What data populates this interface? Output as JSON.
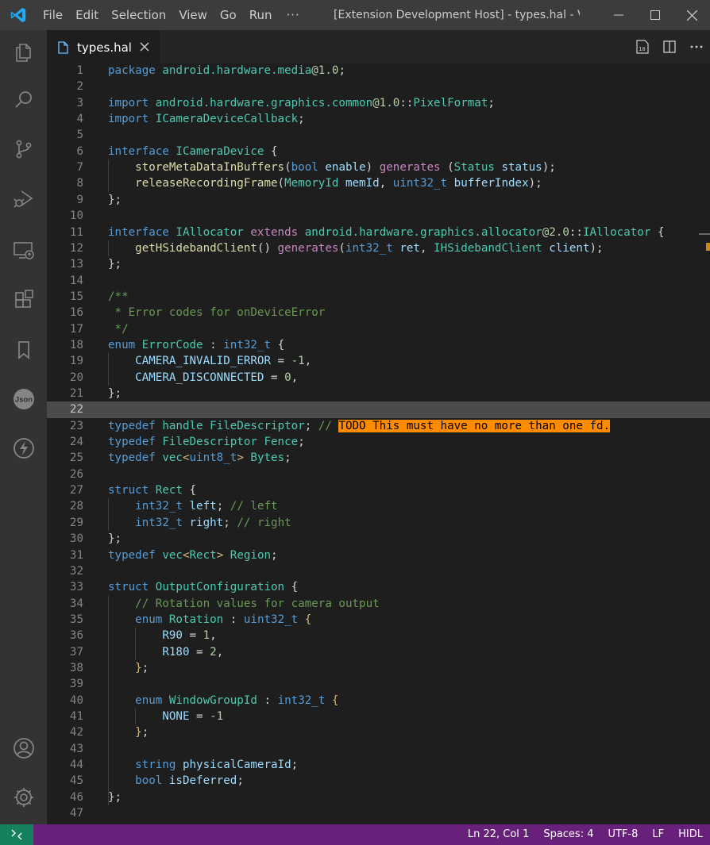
{
  "titlebar": {
    "menus": [
      "File",
      "Edit",
      "Selection",
      "View",
      "Go",
      "Run"
    ],
    "more": "···",
    "title": "[Extension Development Host] - types.hal - Vis..."
  },
  "activitybar": {
    "items": [
      "explorer-icon",
      "search-icon",
      "source-control-icon",
      "run-debug-icon",
      "remote-explorer-icon",
      "extensions-icon",
      "bookmarks-icon",
      "json-icon",
      "lightning-icon"
    ],
    "bottom": [
      "account-icon",
      "settings-gear-icon"
    ]
  },
  "tab": {
    "label": "types.hal"
  },
  "editor": {
    "current_line": 22,
    "line_numbers": [
      "1",
      "2",
      "3",
      "4",
      "5",
      "6",
      "7",
      "8",
      "9",
      "10",
      "11",
      "12",
      "13",
      "14",
      "15",
      "16",
      "17",
      "18",
      "19",
      "20",
      "21",
      "22",
      "23",
      "24",
      "25",
      "26",
      "27",
      "28",
      "29",
      "30",
      "31",
      "32",
      "33",
      "34",
      "35",
      "36",
      "37",
      "38",
      "39",
      "40",
      "41",
      "42",
      "43",
      "44",
      "45",
      "46",
      "47"
    ],
    "lines": [
      [
        [
          "kw",
          "package "
        ],
        [
          "ty",
          "android.hardware.media"
        ],
        [
          "nm",
          "@1.0"
        ],
        [
          "pl",
          ";"
        ]
      ],
      [],
      [
        [
          "kw",
          "import "
        ],
        [
          "ty",
          "android.hardware.graphics.common"
        ],
        [
          "nm",
          "@1.0"
        ],
        [
          "pl",
          "::"
        ],
        [
          "ty",
          "PixelFormat"
        ],
        [
          "pl",
          ";"
        ]
      ],
      [
        [
          "kw",
          "import "
        ],
        [
          "ty",
          "ICameraDeviceCallback"
        ],
        [
          "pl",
          ";"
        ]
      ],
      [],
      [
        [
          "kw",
          "interface "
        ],
        [
          "ty",
          "ICameraDevice "
        ],
        [
          "pl",
          "{"
        ]
      ],
      [
        [
          "pl",
          "    "
        ],
        [
          "fn",
          "storeMetaDataInBuffers"
        ],
        [
          "pl",
          "("
        ],
        [
          "kw",
          "bool "
        ],
        [
          "id",
          "enable"
        ],
        [
          "pl",
          ") "
        ],
        [
          "ky",
          "generates "
        ],
        [
          "pl",
          "("
        ],
        [
          "ty",
          "Status "
        ],
        [
          "id",
          "status"
        ],
        [
          "pl",
          ");"
        ]
      ],
      [
        [
          "pl",
          "    "
        ],
        [
          "fn",
          "releaseRecordingFrame"
        ],
        [
          "pl",
          "("
        ],
        [
          "ty",
          "MemoryId "
        ],
        [
          "id",
          "memId"
        ],
        [
          "pl",
          ", "
        ],
        [
          "kw",
          "uint32_t "
        ],
        [
          "id",
          "bufferIndex"
        ],
        [
          "pl",
          ");"
        ]
      ],
      [
        [
          "pl",
          "};"
        ]
      ],
      [],
      [
        [
          "kw",
          "interface "
        ],
        [
          "ty",
          "IAllocator "
        ],
        [
          "ky",
          "extends "
        ],
        [
          "ty",
          "android.hardware.graphics.allocator"
        ],
        [
          "nm",
          "@2.0"
        ],
        [
          "pl",
          "::"
        ],
        [
          "ty",
          "IAllocator "
        ],
        [
          "pl",
          "{"
        ]
      ],
      [
        [
          "pl",
          "    "
        ],
        [
          "fn",
          "getHSidebandClient"
        ],
        [
          "pl",
          "() "
        ],
        [
          "ky",
          "generates"
        ],
        [
          "pl",
          "("
        ],
        [
          "kw",
          "int32_t "
        ],
        [
          "id",
          "ret"
        ],
        [
          "pl",
          ", "
        ],
        [
          "ty",
          "IHSidebandClient "
        ],
        [
          "id",
          "client"
        ],
        [
          "pl",
          ");"
        ]
      ],
      [
        [
          "pl",
          "};"
        ]
      ],
      [],
      [
        [
          "cm",
          "/**"
        ]
      ],
      [
        [
          "cm",
          " * Error codes for onDeviceError"
        ]
      ],
      [
        [
          "cm",
          " */"
        ]
      ],
      [
        [
          "kw",
          "enum "
        ],
        [
          "ty",
          "ErrorCode "
        ],
        [
          "pl",
          ": "
        ],
        [
          "kw",
          "int32_t "
        ],
        [
          "pl",
          "{"
        ]
      ],
      [
        [
          "pl",
          "    "
        ],
        [
          "id",
          "CAMERA_INVALID_ERROR"
        ],
        [
          "pl",
          " = "
        ],
        [
          "nm",
          "-1"
        ],
        [
          "pl",
          ","
        ]
      ],
      [
        [
          "pl",
          "    "
        ],
        [
          "id",
          "CAMERA_DISCONNECTED"
        ],
        [
          "pl",
          " = "
        ],
        [
          "nm",
          "0"
        ],
        [
          "pl",
          ","
        ]
      ],
      [
        [
          "pl",
          "};"
        ]
      ],
      [],
      [
        [
          "kw",
          "typedef "
        ],
        [
          "ty",
          "handle FileDescriptor"
        ],
        [
          "pl",
          "; "
        ],
        [
          "cm",
          "// "
        ],
        [
          "hl",
          "TODO This must have no more than one fd."
        ]
      ],
      [
        [
          "kw",
          "typedef "
        ],
        [
          "ty",
          "FileDescriptor Fence"
        ],
        [
          "pl",
          ";"
        ]
      ],
      [
        [
          "kw",
          "typedef "
        ],
        [
          "ty",
          "vec"
        ],
        [
          "br",
          "<"
        ],
        [
          "kw",
          "uint8_t"
        ],
        [
          "br",
          "> "
        ],
        [
          "ty",
          "Bytes"
        ],
        [
          "pl",
          ";"
        ]
      ],
      [],
      [
        [
          "kw",
          "struct "
        ],
        [
          "ty",
          "Rect "
        ],
        [
          "pl",
          "{"
        ]
      ],
      [
        [
          "pl",
          "    "
        ],
        [
          "kw",
          "int32_t "
        ],
        [
          "id",
          "left"
        ],
        [
          "pl",
          "; "
        ],
        [
          "cm",
          "// left"
        ]
      ],
      [
        [
          "pl",
          "    "
        ],
        [
          "kw",
          "int32_t "
        ],
        [
          "id",
          "right"
        ],
        [
          "pl",
          "; "
        ],
        [
          "cm",
          "// right"
        ]
      ],
      [
        [
          "pl",
          "};"
        ]
      ],
      [
        [
          "kw",
          "typedef "
        ],
        [
          "ty",
          "vec"
        ],
        [
          "br",
          "<"
        ],
        [
          "ty",
          "Rect"
        ],
        [
          "br",
          "> "
        ],
        [
          "ty",
          "Region"
        ],
        [
          "pl",
          ";"
        ]
      ],
      [],
      [
        [
          "kw",
          "struct "
        ],
        [
          "ty",
          "OutputConfiguration "
        ],
        [
          "pl",
          "{"
        ]
      ],
      [
        [
          "pl",
          "    "
        ],
        [
          "cm",
          "// Rotation values for camera output"
        ]
      ],
      [
        [
          "pl",
          "    "
        ],
        [
          "kw",
          "enum "
        ],
        [
          "ty",
          "Rotation "
        ],
        [
          "pl",
          ": "
        ],
        [
          "kw",
          "uint32_t "
        ],
        [
          "br",
          "{"
        ]
      ],
      [
        [
          "pl",
          "        "
        ],
        [
          "id",
          "R90"
        ],
        [
          "pl",
          " = "
        ],
        [
          "nm",
          "1"
        ],
        [
          "pl",
          ","
        ]
      ],
      [
        [
          "pl",
          "        "
        ],
        [
          "id",
          "R180"
        ],
        [
          "pl",
          " = "
        ],
        [
          "nm",
          "2"
        ],
        [
          "pl",
          ","
        ]
      ],
      [
        [
          "pl",
          "    "
        ],
        [
          "br",
          "}"
        ],
        [
          "pl",
          ";"
        ]
      ],
      [],
      [
        [
          "pl",
          "    "
        ],
        [
          "kw",
          "enum "
        ],
        [
          "ty",
          "WindowGroupId "
        ],
        [
          "pl",
          ": "
        ],
        [
          "kw",
          "int32_t "
        ],
        [
          "br",
          "{"
        ]
      ],
      [
        [
          "pl",
          "        "
        ],
        [
          "id",
          "NONE"
        ],
        [
          "pl",
          " = "
        ],
        [
          "nm",
          "-1"
        ]
      ],
      [
        [
          "pl",
          "    "
        ],
        [
          "br",
          "}"
        ],
        [
          "pl",
          ";"
        ]
      ],
      [],
      [
        [
          "pl",
          "    "
        ],
        [
          "kw",
          "string "
        ],
        [
          "id",
          "physicalCameraId"
        ],
        [
          "pl",
          ";"
        ]
      ],
      [
        [
          "pl",
          "    "
        ],
        [
          "kw",
          "bool "
        ],
        [
          "id",
          "isDeferred"
        ],
        [
          "pl",
          ";"
        ]
      ],
      [
        [
          "pl",
          "};"
        ]
      ],
      []
    ]
  },
  "statusbar": {
    "position": "Ln 22, Col 1",
    "spaces": "Spaces: 4",
    "encoding": "UTF-8",
    "eol": "LF",
    "language": "HIDL"
  },
  "colors": {
    "statusbar": "#68217a",
    "remote": "#16825d",
    "accent": "#007acc",
    "todo_highlight": "#ff8c00"
  }
}
